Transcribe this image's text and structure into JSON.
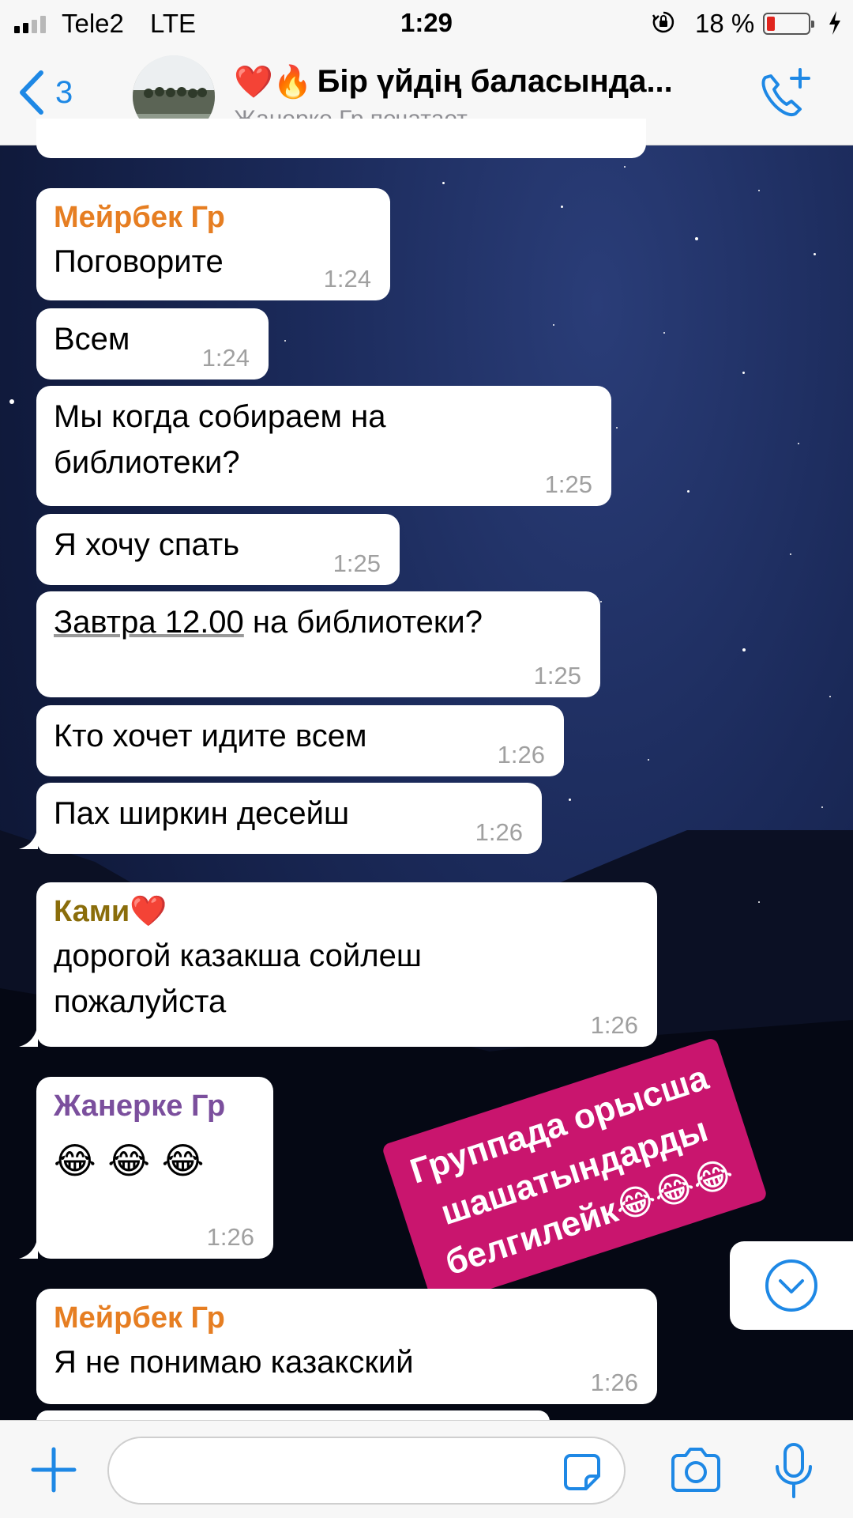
{
  "status_bar": {
    "carrier": "Tele2",
    "network": "LTE",
    "time": "1:29",
    "battery_percent": "18 %"
  },
  "header": {
    "back_count": "3",
    "title_emoji": "❤️🔥",
    "title": "Бір үйдің баласында...",
    "subtitle": "Жанерке Гр печатает..."
  },
  "messages": [
    {
      "sender": "Мейрбек Гр",
      "sender_color": "#e67e22",
      "text": "Поговорите",
      "time": "1:24"
    },
    {
      "sender": "",
      "text": "Всем",
      "time": "1:24"
    },
    {
      "sender": "",
      "text": "Мы когда собираем на библиотеки?",
      "time": "1:25"
    },
    {
      "sender": "",
      "text": "Я хочу спать",
      "time": "1:25"
    },
    {
      "sender": "",
      "text_link": "Завтра 12.00",
      "text": " на библиотеки?",
      "time": "1:25"
    },
    {
      "sender": "",
      "text": "Кто хочет идите всем",
      "time": "1:26"
    },
    {
      "sender": "",
      "text": "Пах ширкин десейш",
      "time": "1:26"
    },
    {
      "sender": "Ками❤️",
      "sender_color": "#8a6d0b",
      "text": "дорогой казакша сойлеш пожалуйста",
      "time": "1:26"
    },
    {
      "sender": "Жанерке Гр",
      "sender_color": "#7b4f9d",
      "text": "😂 😂 😂",
      "time": "1:26"
    },
    {
      "sender": "Мейрбек Гр",
      "sender_color": "#e67e22",
      "text": "Я не понимаю казакский",
      "time": "1:26"
    }
  ],
  "sticker": {
    "line1": "Группада орысша",
    "line2": "шашатындарды",
    "line3": "белгилейк😂😂😂",
    "color": "#c9156e"
  },
  "input": {
    "value": "",
    "placeholder": ""
  },
  "colors": {
    "accent": "#1e88e5",
    "bubble": "#ffffff",
    "battery_low": "#e0251e"
  },
  "icons": [
    "plus-icon",
    "sticker-icon",
    "camera-icon",
    "microphone-icon",
    "chevron-down-icon",
    "phone-plus-icon",
    "chevron-left-icon",
    "orientation-lock-icon",
    "charging-icon"
  ]
}
